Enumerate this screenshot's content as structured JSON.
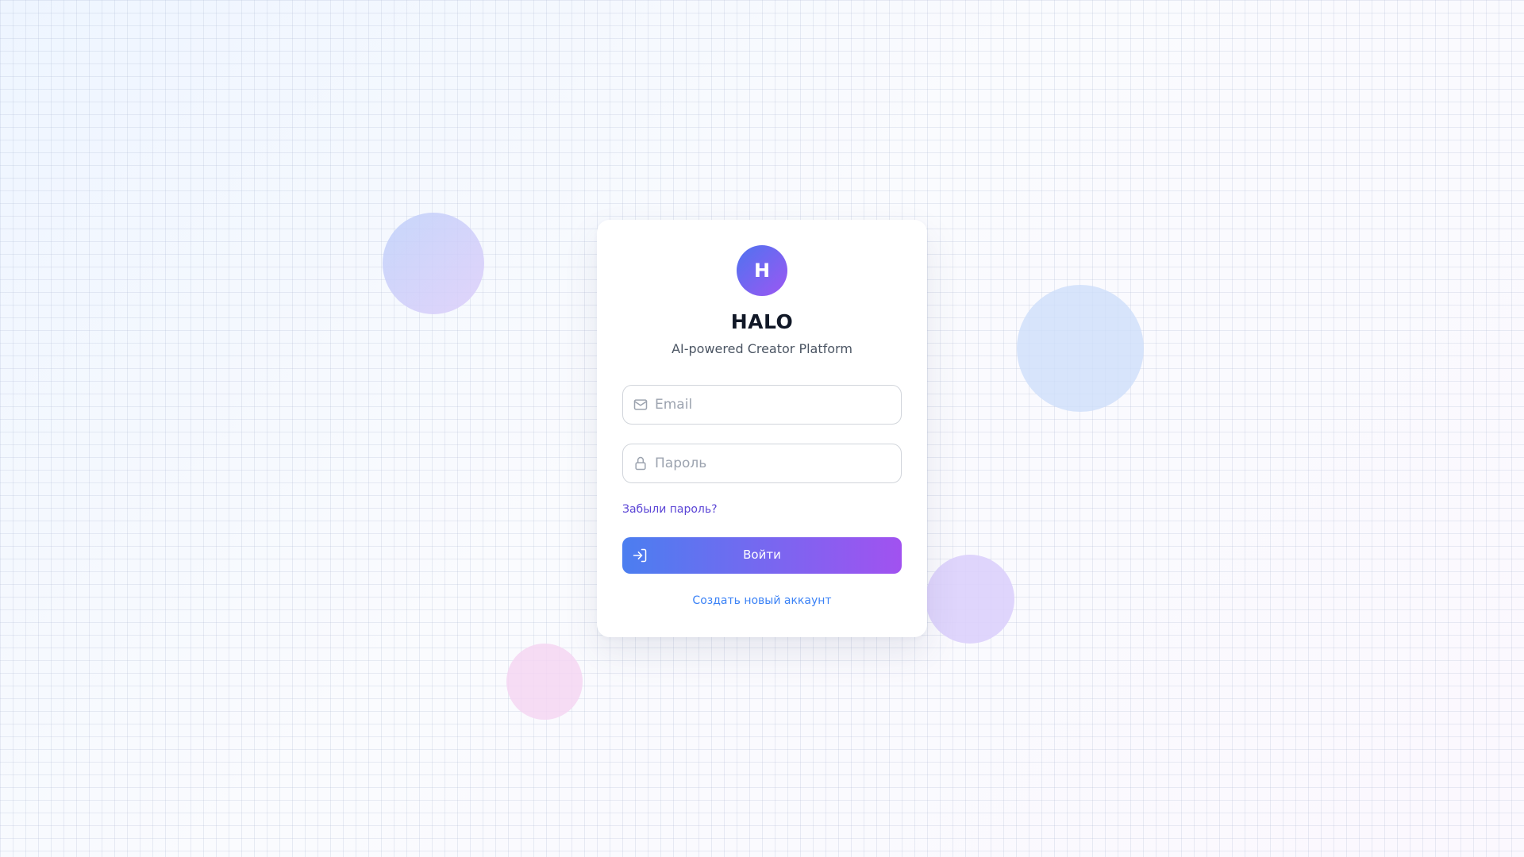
{
  "brand": {
    "logo_letter": "H",
    "name": "HALO",
    "tagline": "AI-powered Creator Platform",
    "accent_gradient": [
      "#4f73f0",
      "#9c57f2"
    ]
  },
  "form": {
    "email": {
      "icon": "mail-icon",
      "value": "",
      "placeholder": "Email"
    },
    "password": {
      "icon": "lock-icon",
      "value": "",
      "placeholder": "Пароль"
    },
    "forgot_label": "Забыли пароль?",
    "submit": {
      "icon": "log-in-icon",
      "label": "Войти",
      "gradient": [
        "#4b7ef0",
        "#a152f0"
      ]
    },
    "register_label": "Создать новый аккаунт"
  },
  "colors": {
    "link_forgot": "#5b45d6",
    "link_register": "#3b82f6",
    "title": "#111827"
  }
}
